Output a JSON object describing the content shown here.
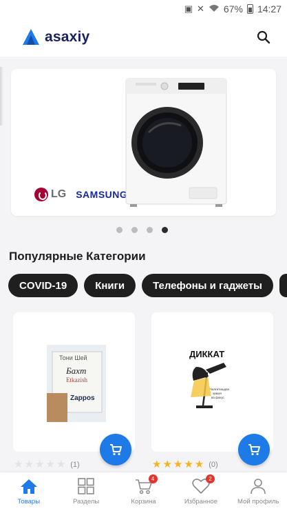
{
  "status_bar": {
    "battery": "67%",
    "time": "14:27"
  },
  "header": {
    "app_name": "asaxiy",
    "brand_color": "#1e7ae6"
  },
  "banner": {
    "brand_1": "LG",
    "brand_2": "SAMSUNG",
    "slide_count": 4,
    "active_slide": 4
  },
  "popular": {
    "title": "Популярные Категории",
    "chips": [
      "COVID-19",
      "Книги",
      "Телефоны и гаджеты"
    ]
  },
  "products": [
    {
      "cover_lines": [
        "Тони Шей",
        "Бахт",
        "Etkazish",
        "Zappos"
      ],
      "rating": 0,
      "reviews": "(1)"
    },
    {
      "cover_lines": [
        "ДИККАТ",
        "Чалғитишдан",
        "ҳимоя",
        "ва фокус"
      ],
      "rating": 5,
      "reviews": "(0)"
    }
  ],
  "bottom_nav": [
    {
      "label": "Товары",
      "icon": "home-icon",
      "active": true
    },
    {
      "label": "Разделы",
      "icon": "grid-icon",
      "active": false
    },
    {
      "label": "Корзина",
      "icon": "cart-icon",
      "badge": "4",
      "active": false
    },
    {
      "label": "Избранное",
      "icon": "heart-icon",
      "badge": "2",
      "active": false
    },
    {
      "label": "Мой профиль",
      "icon": "user-icon",
      "active": false
    }
  ]
}
